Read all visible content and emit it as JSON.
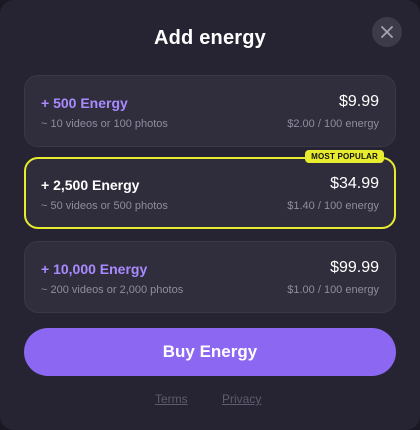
{
  "dialog": {
    "title": "Add energy"
  },
  "plans": [
    {
      "name": "+ 500 Energy",
      "name_color": "#a98bff",
      "subtitle": "~ 10 videos or 100 photos",
      "price": "$9.99",
      "rate": "$2.00 / 100 energy",
      "selected": false
    },
    {
      "name": "+ 2,500 Energy",
      "name_color": "#ffffff",
      "subtitle": "~ 50 videos or 500 photos",
      "price": "$34.99",
      "rate": "$1.40 / 100 energy",
      "selected": true,
      "badge": "MOST POPULAR"
    },
    {
      "name": "+ 10,000 Energy",
      "name_color": "#a98bff",
      "subtitle": "~ 200 videos or 2,000 photos",
      "price": "$99.99",
      "rate": "$1.00 / 100 energy",
      "selected": false
    }
  ],
  "buy_button": {
    "label": "Buy Energy"
  },
  "footer": {
    "terms": "Terms",
    "privacy": "Privacy"
  },
  "colors": {
    "accent": "#8c68f2",
    "highlight": "#e8ec2e",
    "plan_accent_text": "#a98bff"
  },
  "icons": {
    "close": "close-icon"
  }
}
